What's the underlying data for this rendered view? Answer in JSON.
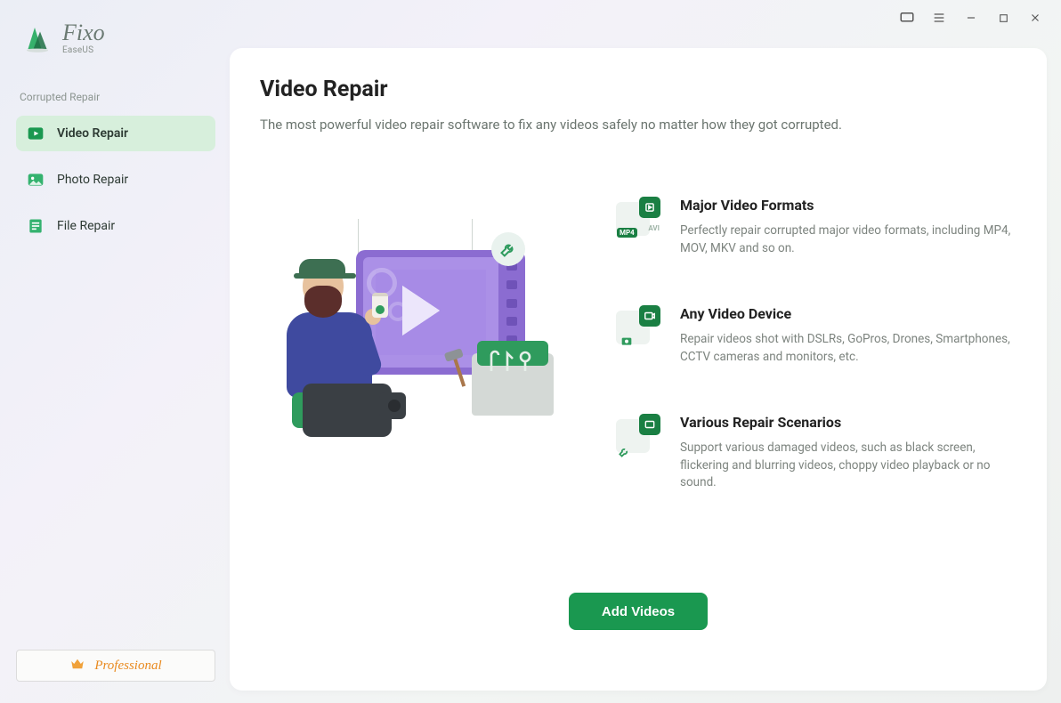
{
  "app": {
    "title": "Fixo",
    "subtitle": "EaseUS"
  },
  "sidebar": {
    "section_label": "Corrupted Repair",
    "items": [
      {
        "label": "Video Repair",
        "icon": "play-icon",
        "active": true
      },
      {
        "label": "Photo Repair",
        "icon": "image-icon",
        "active": false
      },
      {
        "label": "File Repair",
        "icon": "document-icon",
        "active": false
      }
    ],
    "pro_label": "Professional"
  },
  "main": {
    "heading": "Video Repair",
    "subtitle": "The most powerful video repair software to fix any videos safely no matter how they got corrupted.",
    "features": [
      {
        "title": "Major Video Formats",
        "desc": "Perfectly repair corrupted major video formats, including MP4, MOV, MKV and so on.",
        "badge_main": "MP4",
        "badge_sub": "AVI"
      },
      {
        "title": "Any Video Device",
        "desc": "Repair videos shot with DSLRs, GoPros, Drones, Smartphones, CCTV cameras and monitors, etc."
      },
      {
        "title": "Various Repair Scenarios",
        "desc": "Support various damaged videos, such as black screen, flickering and blurring videos, choppy video playback or no sound."
      }
    ],
    "cta_label": "Add Videos"
  }
}
